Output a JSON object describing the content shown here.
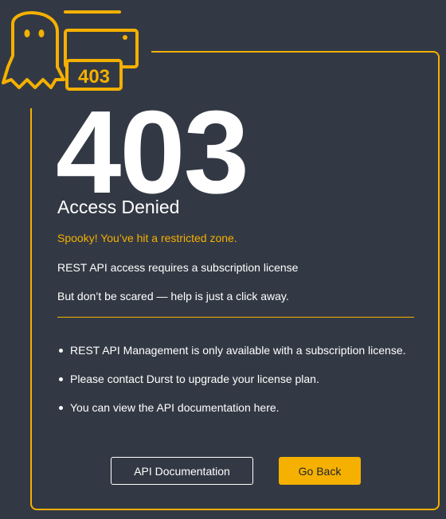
{
  "logo": {
    "badge_text": "403"
  },
  "error": {
    "code": "403",
    "title": "Access Denied",
    "spooky_message": "Spooky! You’ve hit a restricted zone.",
    "message_1": "REST API access requires a subscription license",
    "message_2": "But don’t be scared — help is just a click away."
  },
  "bullets": [
    "REST API Management is only available with a subscription license.",
    "Please contact Durst to upgrade your license plan.",
    "You can view the API documentation here."
  ],
  "buttons": {
    "docs_label": "API Documentation",
    "back_label": "Go Back"
  },
  "colors": {
    "background": "#333944",
    "accent": "#f5b000",
    "text": "#ffffff"
  }
}
